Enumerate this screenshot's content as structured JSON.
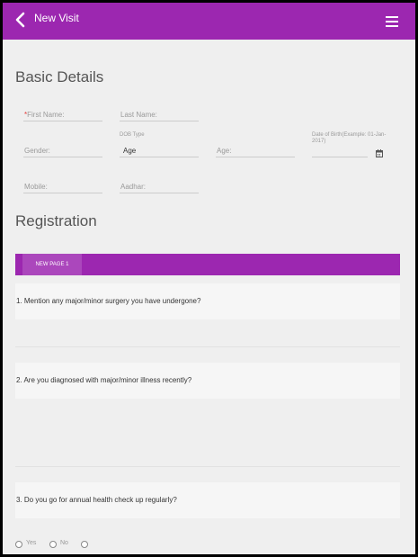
{
  "header": {
    "title": "New Visit"
  },
  "basic_details": {
    "heading": "Basic Details",
    "first_name": {
      "required_mark": "*",
      "placeholder": "First Name:"
    },
    "last_name": {
      "placeholder": "Last Name:"
    },
    "gender": {
      "placeholder": "Gender:"
    },
    "dob_type": {
      "label": "DOB Type",
      "value": "Age"
    },
    "age": {
      "placeholder": "Age:"
    },
    "dob": {
      "placeholder": "Date of Birth(Example: 01-Jan-2017)"
    },
    "mobile": {
      "placeholder": "Mobile:"
    },
    "aadhar": {
      "placeholder": "Aadhar:"
    }
  },
  "registration": {
    "heading": "Registration",
    "tabs": [
      {
        "label": "NEW PAGE 1"
      }
    ],
    "questions": [
      {
        "text": "1. Mention any major/minor surgery you have undergone?"
      },
      {
        "text": "2. Are you diagnosed with major/minor illness recently?"
      },
      {
        "text": "3. Do you go for annual health check up regularly?"
      }
    ],
    "q3_options": [
      {
        "label": "Yes"
      },
      {
        "label": "No"
      },
      {
        "label": ""
      }
    ]
  },
  "colors": {
    "accent": "#9c27b0",
    "tab_active": "#ab47bc",
    "background": "#efefef",
    "required": "#e53935"
  }
}
